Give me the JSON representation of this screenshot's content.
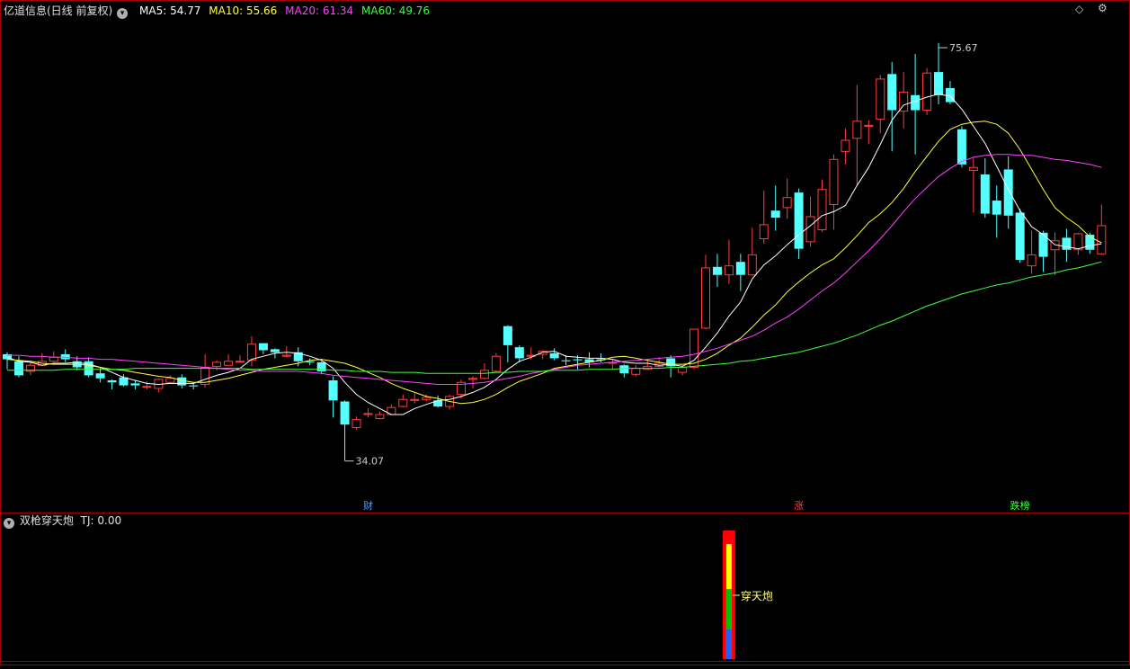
{
  "header": {
    "title": "亿道信息(日线 前复权)",
    "ma5": "MA5: 54.77",
    "ma10": "MA10: 55.66",
    "ma20": "MA20: 61.34",
    "ma60": "MA60: 49.76"
  },
  "sub_header": {
    "title": "双枪穿天炮",
    "tj": "TJ: 0.00"
  },
  "colors": {
    "up": "#ff3c3c",
    "down": "#54ffff",
    "ma5": "#ffffff",
    "ma10": "#ffff40",
    "ma20": "#ff40ff",
    "ma60": "#40ff40",
    "frame": "#a00000"
  },
  "icons": {
    "menu": "chevron-down-icon",
    "settings": "gear-icon",
    "diamond": "diamond-icon"
  },
  "chart_data": {
    "type": "candlestick",
    "title": "亿道信息(日线 前复权)",
    "ylim": [
      31,
      78
    ],
    "candles": [
      [
        44.7,
        44.2,
        44.9,
        43.2
      ],
      [
        44.0,
        42.6,
        44.5,
        42.4
      ],
      [
        43.0,
        43.6,
        43.9,
        42.6
      ],
      [
        43.6,
        44.0,
        44.8,
        43.6
      ],
      [
        44.0,
        44.4,
        45.0,
        43.9
      ],
      [
        44.7,
        44.2,
        45.2,
        43.9
      ],
      [
        44.0,
        43.4,
        44.5,
        43.1
      ],
      [
        44.0,
        42.6,
        44.4,
        42.4
      ],
      [
        42.8,
        42.3,
        43.4,
        41.9
      ],
      [
        42.1,
        41.9,
        42.2,
        41.2
      ],
      [
        42.4,
        41.6,
        42.7,
        41.5
      ],
      [
        41.8,
        41.6,
        42.1,
        41.2
      ],
      [
        41.5,
        41.5,
        42.0,
        41.2
      ],
      [
        41.3,
        42.2,
        42.3,
        40.9
      ],
      [
        41.9,
        42.3,
        42.6,
        41.8
      ],
      [
        42.4,
        41.6,
        42.7,
        41.3
      ],
      [
        41.6,
        41.5,
        41.8,
        41.2
      ],
      [
        41.7,
        43.4,
        44.7,
        41.4
      ],
      [
        43.5,
        43.9,
        44.1,
        43.1
      ],
      [
        43.6,
        44.0,
        44.7,
        43.6
      ],
      [
        44.0,
        44.0,
        44.6,
        43.9
      ],
      [
        44.1,
        45.7,
        46.5,
        43.5
      ],
      [
        45.8,
        45.1,
        45.8,
        44.7
      ],
      [
        45.2,
        44.9,
        45.3,
        44.3
      ],
      [
        44.5,
        44.6,
        45.5,
        44.4
      ],
      [
        44.9,
        44.0,
        45.4,
        43.5
      ],
      [
        44.0,
        43.9,
        44.3,
        43.6
      ],
      [
        43.9,
        43.0,
        44.0,
        42.7
      ],
      [
        42.1,
        40.1,
        42.5,
        38.4
      ],
      [
        40.0,
        37.7,
        40.1,
        34.1
      ],
      [
        37.4,
        38.2,
        38.5,
        37.2
      ],
      [
        38.7,
        38.8,
        39.3,
        38.4
      ],
      [
        38.3,
        38.7,
        39.0,
        38.2
      ],
      [
        38.7,
        39.4,
        39.7,
        38.6
      ],
      [
        39.5,
        40.2,
        40.7,
        39.4
      ],
      [
        40.1,
        40.2,
        40.8,
        39.8
      ],
      [
        40.2,
        40.4,
        40.7,
        40.0
      ],
      [
        40.1,
        39.5,
        40.6,
        39.4
      ],
      [
        39.5,
        40.5,
        40.7,
        39.2
      ],
      [
        40.7,
        41.9,
        42.2,
        40.3
      ],
      [
        42.2,
        42.3,
        42.5,
        41.3
      ],
      [
        42.3,
        43.1,
        43.8,
        42.2
      ],
      [
        43.0,
        44.5,
        44.8,
        42.9
      ],
      [
        47.5,
        45.6,
        47.6,
        43.9
      ],
      [
        45.4,
        44.3,
        45.6,
        43.9
      ],
      [
        44.5,
        44.6,
        45.4,
        44.2
      ],
      [
        44.7,
        45.0,
        45.1,
        44.2
      ],
      [
        44.8,
        44.3,
        45.3,
        44.1
      ],
      [
        44.1,
        44.0,
        44.6,
        43.6
      ],
      [
        44.2,
        44.1,
        44.6,
        43.2
      ],
      [
        44.2,
        43.9,
        44.9,
        43.4
      ],
      [
        44.2,
        44.1,
        44.8,
        43.9
      ],
      [
        43.8,
        43.9,
        44.2,
        43.2
      ],
      [
        43.6,
        42.8,
        43.7,
        42.4
      ],
      [
        42.7,
        43.3,
        43.6,
        42.5
      ],
      [
        43.2,
        43.5,
        44.2,
        43.1
      ],
      [
        43.5,
        43.8,
        44.4,
        43.4
      ],
      [
        44.3,
        43.5,
        44.6,
        42.4
      ],
      [
        42.9,
        43.4,
        43.6,
        42.6
      ],
      [
        43.4,
        47.2,
        47.2,
        43.2
      ],
      [
        47.3,
        53.3,
        54.6,
        47.2
      ],
      [
        53.4,
        52.6,
        54.7,
        51.4
      ],
      [
        52.6,
        53.5,
        56.1,
        51.7
      ],
      [
        53.9,
        52.6,
        54.7,
        51.0
      ],
      [
        52.6,
        54.6,
        57.3,
        52.5
      ],
      [
        56.2,
        57.6,
        61.0,
        55.7
      ],
      [
        59.0,
        58.3,
        61.5,
        57.0
      ],
      [
        59.3,
        60.3,
        62.2,
        58.2
      ],
      [
        60.8,
        55.2,
        61.2,
        54.2
      ],
      [
        55.9,
        58.4,
        60.4,
        55.4
      ],
      [
        57.1,
        61.1,
        62.1,
        56.9
      ],
      [
        59.6,
        64.1,
        64.6,
        57.1
      ],
      [
        64.9,
        66.0,
        67.2,
        63.6
      ],
      [
        66.2,
        67.9,
        71.5,
        61.5
      ],
      [
        67.4,
        67.5,
        68.0,
        65.6
      ],
      [
        68.1,
        72.1,
        72.5,
        66.7
      ],
      [
        72.6,
        69.0,
        73.8,
        64.9
      ],
      [
        68.9,
        70.8,
        72.8,
        67.2
      ],
      [
        70.5,
        69.0,
        74.6,
        64.6
      ],
      [
        69.0,
        72.7,
        73.2,
        68.5
      ],
      [
        72.8,
        70.5,
        75.7,
        69.6
      ],
      [
        71.2,
        69.8,
        71.9,
        69.6
      ],
      [
        67.1,
        63.6,
        67.4,
        63.3
      ],
      [
        63.0,
        63.3,
        64.2,
        58.8
      ],
      [
        62.6,
        58.7,
        64.2,
        58.3
      ],
      [
        60.0,
        58.6,
        61.5,
        56.3
      ],
      [
        63.1,
        58.5,
        64.4,
        57.2
      ],
      [
        58.8,
        54.1,
        59.2,
        53.8
      ],
      [
        53.5,
        54.6,
        57.0,
        52.7
      ],
      [
        56.8,
        54.4,
        57.0,
        52.9
      ],
      [
        55.1,
        56.0,
        56.8,
        52.6
      ],
      [
        56.3,
        55.1,
        57.2,
        53.9
      ],
      [
        55.1,
        56.7,
        56.8,
        54.6
      ],
      [
        56.6,
        55.1,
        56.8,
        54.7
      ],
      [
        54.7,
        57.5,
        59.6,
        54.6
      ]
    ],
    "series": [
      {
        "name": "MA5",
        "values": [
          44.4,
          44.0,
          43.9,
          43.6,
          43.8,
          43.8,
          43.9,
          43.7,
          43.4,
          42.9,
          42.4,
          42.1,
          41.8,
          41.7,
          41.8,
          41.8,
          41.8,
          42.2,
          42.6,
          42.9,
          43.3,
          44.2,
          44.5,
          44.8,
          44.9,
          44.8,
          44.5,
          44.1,
          43.3,
          41.9,
          40.7,
          39.9,
          39.3,
          38.7,
          38.7,
          39.3,
          39.7,
          40.1,
          40.2,
          40.5,
          40.9,
          41.4,
          42.2,
          43.2,
          44.0,
          44.4,
          44.9,
          45.0,
          44.5,
          44.4,
          44.3,
          44.3,
          44.2,
          43.9,
          43.8,
          43.8,
          43.6,
          43.7,
          43.5,
          44.1,
          45.4,
          46.8,
          48.5,
          49.9,
          52.2,
          53.6,
          54.5,
          55.6,
          56.6,
          57.5,
          58.5,
          58.9,
          59.5,
          61.5,
          63.3,
          65.6,
          68.0,
          69.5,
          69.9,
          70.3,
          70.6,
          70.4,
          69.1,
          67.4,
          65.7,
          63.4,
          61.1,
          59.0,
          57.4,
          56.6,
          55.6,
          55.4,
          55.2,
          55.5,
          55.7
        ]
      },
      {
        "name": "MA10",
        "values": [
          44.2,
          44.1,
          44.0,
          43.8,
          43.7,
          43.7,
          43.7,
          43.6,
          43.4,
          43.2,
          43.1,
          42.9,
          42.7,
          42.5,
          42.4,
          42.1,
          41.9,
          41.9,
          42.1,
          42.3,
          42.6,
          42.9,
          43.2,
          43.4,
          43.6,
          43.8,
          44.1,
          44.2,
          44.0,
          43.8,
          43.4,
          42.9,
          42.4,
          41.8,
          41.3,
          40.9,
          40.5,
          40.3,
          40.0,
          39.8,
          39.9,
          40.2,
          40.7,
          41.4,
          42.0,
          42.4,
          42.8,
          43.3,
          43.5,
          43.7,
          43.9,
          44.1,
          44.4,
          44.5,
          44.3,
          44.1,
          43.9,
          43.7,
          43.7,
          43.8,
          44.2,
          44.8,
          45.6,
          46.3,
          47.4,
          48.6,
          49.6,
          50.9,
          51.9,
          52.8,
          53.6,
          54.2,
          55.3,
          56.5,
          57.8,
          58.7,
          59.8,
          61.2,
          62.9,
          64.4,
          65.9,
          67.1,
          67.6,
          67.8,
          67.9,
          67.6,
          66.7,
          65.1,
          63.1,
          61.1,
          59.3,
          58.3,
          57.5,
          56.4,
          55.8
        ]
      },
      {
        "name": "MA20",
        "values": [
          44.6,
          44.6,
          44.5,
          44.5,
          44.4,
          44.4,
          44.3,
          44.3,
          44.2,
          44.2,
          44.1,
          44.0,
          43.9,
          43.8,
          43.7,
          43.6,
          43.5,
          43.4,
          43.3,
          43.2,
          43.1,
          43.1,
          43.0,
          43.0,
          43.0,
          43.0,
          42.9,
          42.8,
          42.6,
          42.5,
          42.4,
          42.3,
          42.2,
          42.1,
          42.0,
          41.9,
          41.8,
          41.7,
          41.7,
          41.7,
          41.8,
          41.9,
          42.1,
          42.3,
          42.5,
          42.8,
          43.0,
          43.2,
          43.4,
          43.6,
          43.7,
          43.8,
          43.9,
          44.0,
          44.1,
          44.2,
          44.3,
          44.4,
          44.5,
          44.7,
          45.0,
          45.3,
          45.7,
          46.1,
          46.5,
          47.1,
          47.8,
          48.4,
          49.2,
          50.1,
          51.0,
          51.8,
          52.8,
          53.9,
          55.0,
          56.2,
          57.5,
          58.9,
          60.2,
          61.3,
          62.4,
          63.2,
          63.9,
          64.3,
          64.5,
          64.6,
          64.6,
          64.5,
          64.5,
          64.3,
          64.1,
          64.0,
          63.8,
          63.6,
          63.3
        ]
      },
      {
        "name": "MA60",
        "values": [
          43.1,
          43.1,
          43.1,
          43.1,
          43.1,
          43.2,
          43.2,
          43.2,
          43.2,
          43.2,
          43.2,
          43.3,
          43.3,
          43.3,
          43.3,
          43.3,
          43.3,
          43.3,
          43.3,
          43.3,
          43.3,
          43.2,
          43.2,
          43.2,
          43.2,
          43.2,
          43.2,
          43.2,
          43.1,
          43.1,
          43.0,
          43.0,
          43.0,
          42.9,
          42.9,
          42.9,
          42.8,
          42.8,
          42.8,
          42.8,
          42.8,
          42.8,
          42.9,
          42.9,
          43.0,
          43.0,
          43.0,
          43.1,
          43.1,
          43.1,
          43.2,
          43.2,
          43.2,
          43.3,
          43.3,
          43.3,
          43.3,
          43.4,
          43.4,
          43.5,
          43.6,
          43.7,
          43.8,
          44.0,
          44.1,
          44.3,
          44.5,
          44.7,
          44.9,
          45.2,
          45.5,
          45.8,
          46.2,
          46.6,
          47.1,
          47.6,
          48.0,
          48.5,
          49.0,
          49.5,
          49.9,
          50.3,
          50.7,
          51.0,
          51.3,
          51.6,
          51.8,
          52.1,
          52.4,
          52.6,
          52.8,
          53.1,
          53.3,
          53.6,
          53.9
        ]
      }
    ],
    "annotations": [
      {
        "label": "75.67",
        "index": 80,
        "value": 75.67
      },
      {
        "label": "34.07",
        "index": 29,
        "value": 34.07
      }
    ],
    "event_markers": [
      {
        "label": "财",
        "index": 31,
        "color": "#4aa0ff"
      },
      {
        "label": "涨",
        "index": 68,
        "color": "#ff4040"
      },
      {
        "label": "跌榜",
        "index": 87,
        "color": "#40ff40"
      }
    ],
    "indicator": {
      "name": "双枪穿天炮",
      "tj": 0.0,
      "signal_index": 62,
      "signal_label": "穿天炮"
    }
  }
}
